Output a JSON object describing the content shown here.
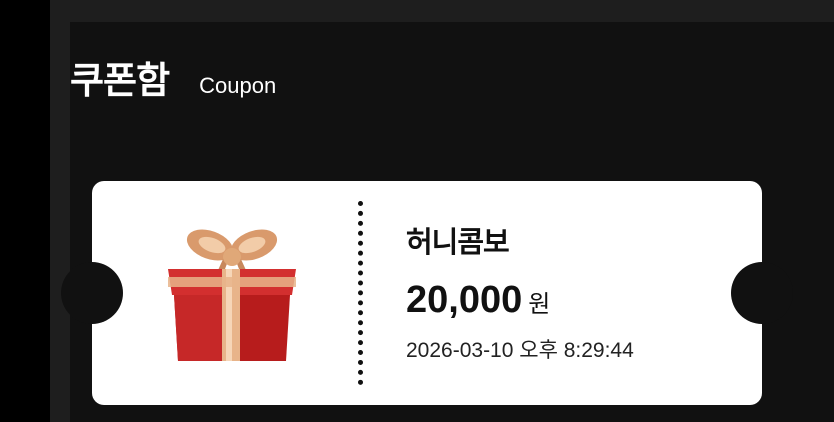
{
  "header": {
    "title": "쿠폰함",
    "subtitle": "Coupon"
  },
  "coupon": {
    "name": "허니콤보",
    "amount": "20,000",
    "unit": "원",
    "date": "2026-03-10 오후 8:29:44",
    "icon": "gift-box-icon"
  },
  "colors": {
    "background": "#111111",
    "card": "#ffffff",
    "gift_red": "#c62828",
    "ribbon_gold": "#e8b48a"
  }
}
